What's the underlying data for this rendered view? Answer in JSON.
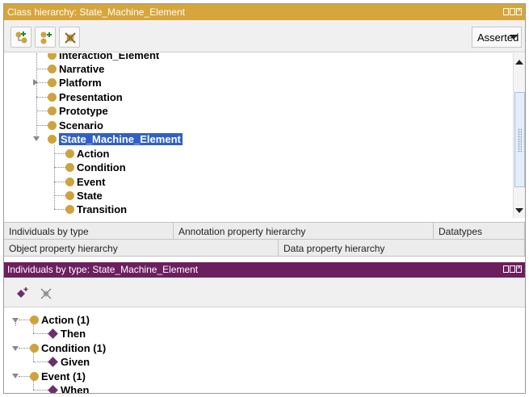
{
  "class_panel": {
    "title": "Class hierarchy: State_Machine_Element",
    "view_mode": "Asserted",
    "tree": [
      {
        "label": "Interaction_Element",
        "partial": true
      },
      {
        "label": "Narrative"
      },
      {
        "label": "Platform",
        "expandable": true
      },
      {
        "label": "Presentation"
      },
      {
        "label": "Prototype"
      },
      {
        "label": "Scenario"
      },
      {
        "label": "State_Machine_Element",
        "selected": true,
        "expanded": true
      },
      {
        "label": "Action"
      },
      {
        "label": "Condition"
      },
      {
        "label": "Event"
      },
      {
        "label": "State"
      },
      {
        "label": "Transition"
      }
    ]
  },
  "tabs": {
    "row1": [
      "Individuals by type",
      "Annotation property hierarchy",
      "Datatypes"
    ],
    "row2": [
      "Object property hierarchy",
      "Data property hierarchy"
    ]
  },
  "individuals_panel": {
    "title": "Individuals by type: State_Machine_Element",
    "tree": [
      {
        "label": "Action (1)",
        "child": "Then"
      },
      {
        "label": "Condition (1)",
        "child": "Given"
      },
      {
        "label": "Event (1)",
        "child": "When"
      }
    ]
  },
  "colors": {
    "class_header": "#d6a53c",
    "individuals_header": "#6c1f5e",
    "class_dot": "#cfa33c",
    "individual_diamond": "#6b2f6b",
    "selection": "#3060c4"
  },
  "icons": [
    "add-subclass-icon",
    "add-sibling-icon",
    "delete-class-icon",
    "add-individual-icon",
    "delete-individual-icon"
  ]
}
